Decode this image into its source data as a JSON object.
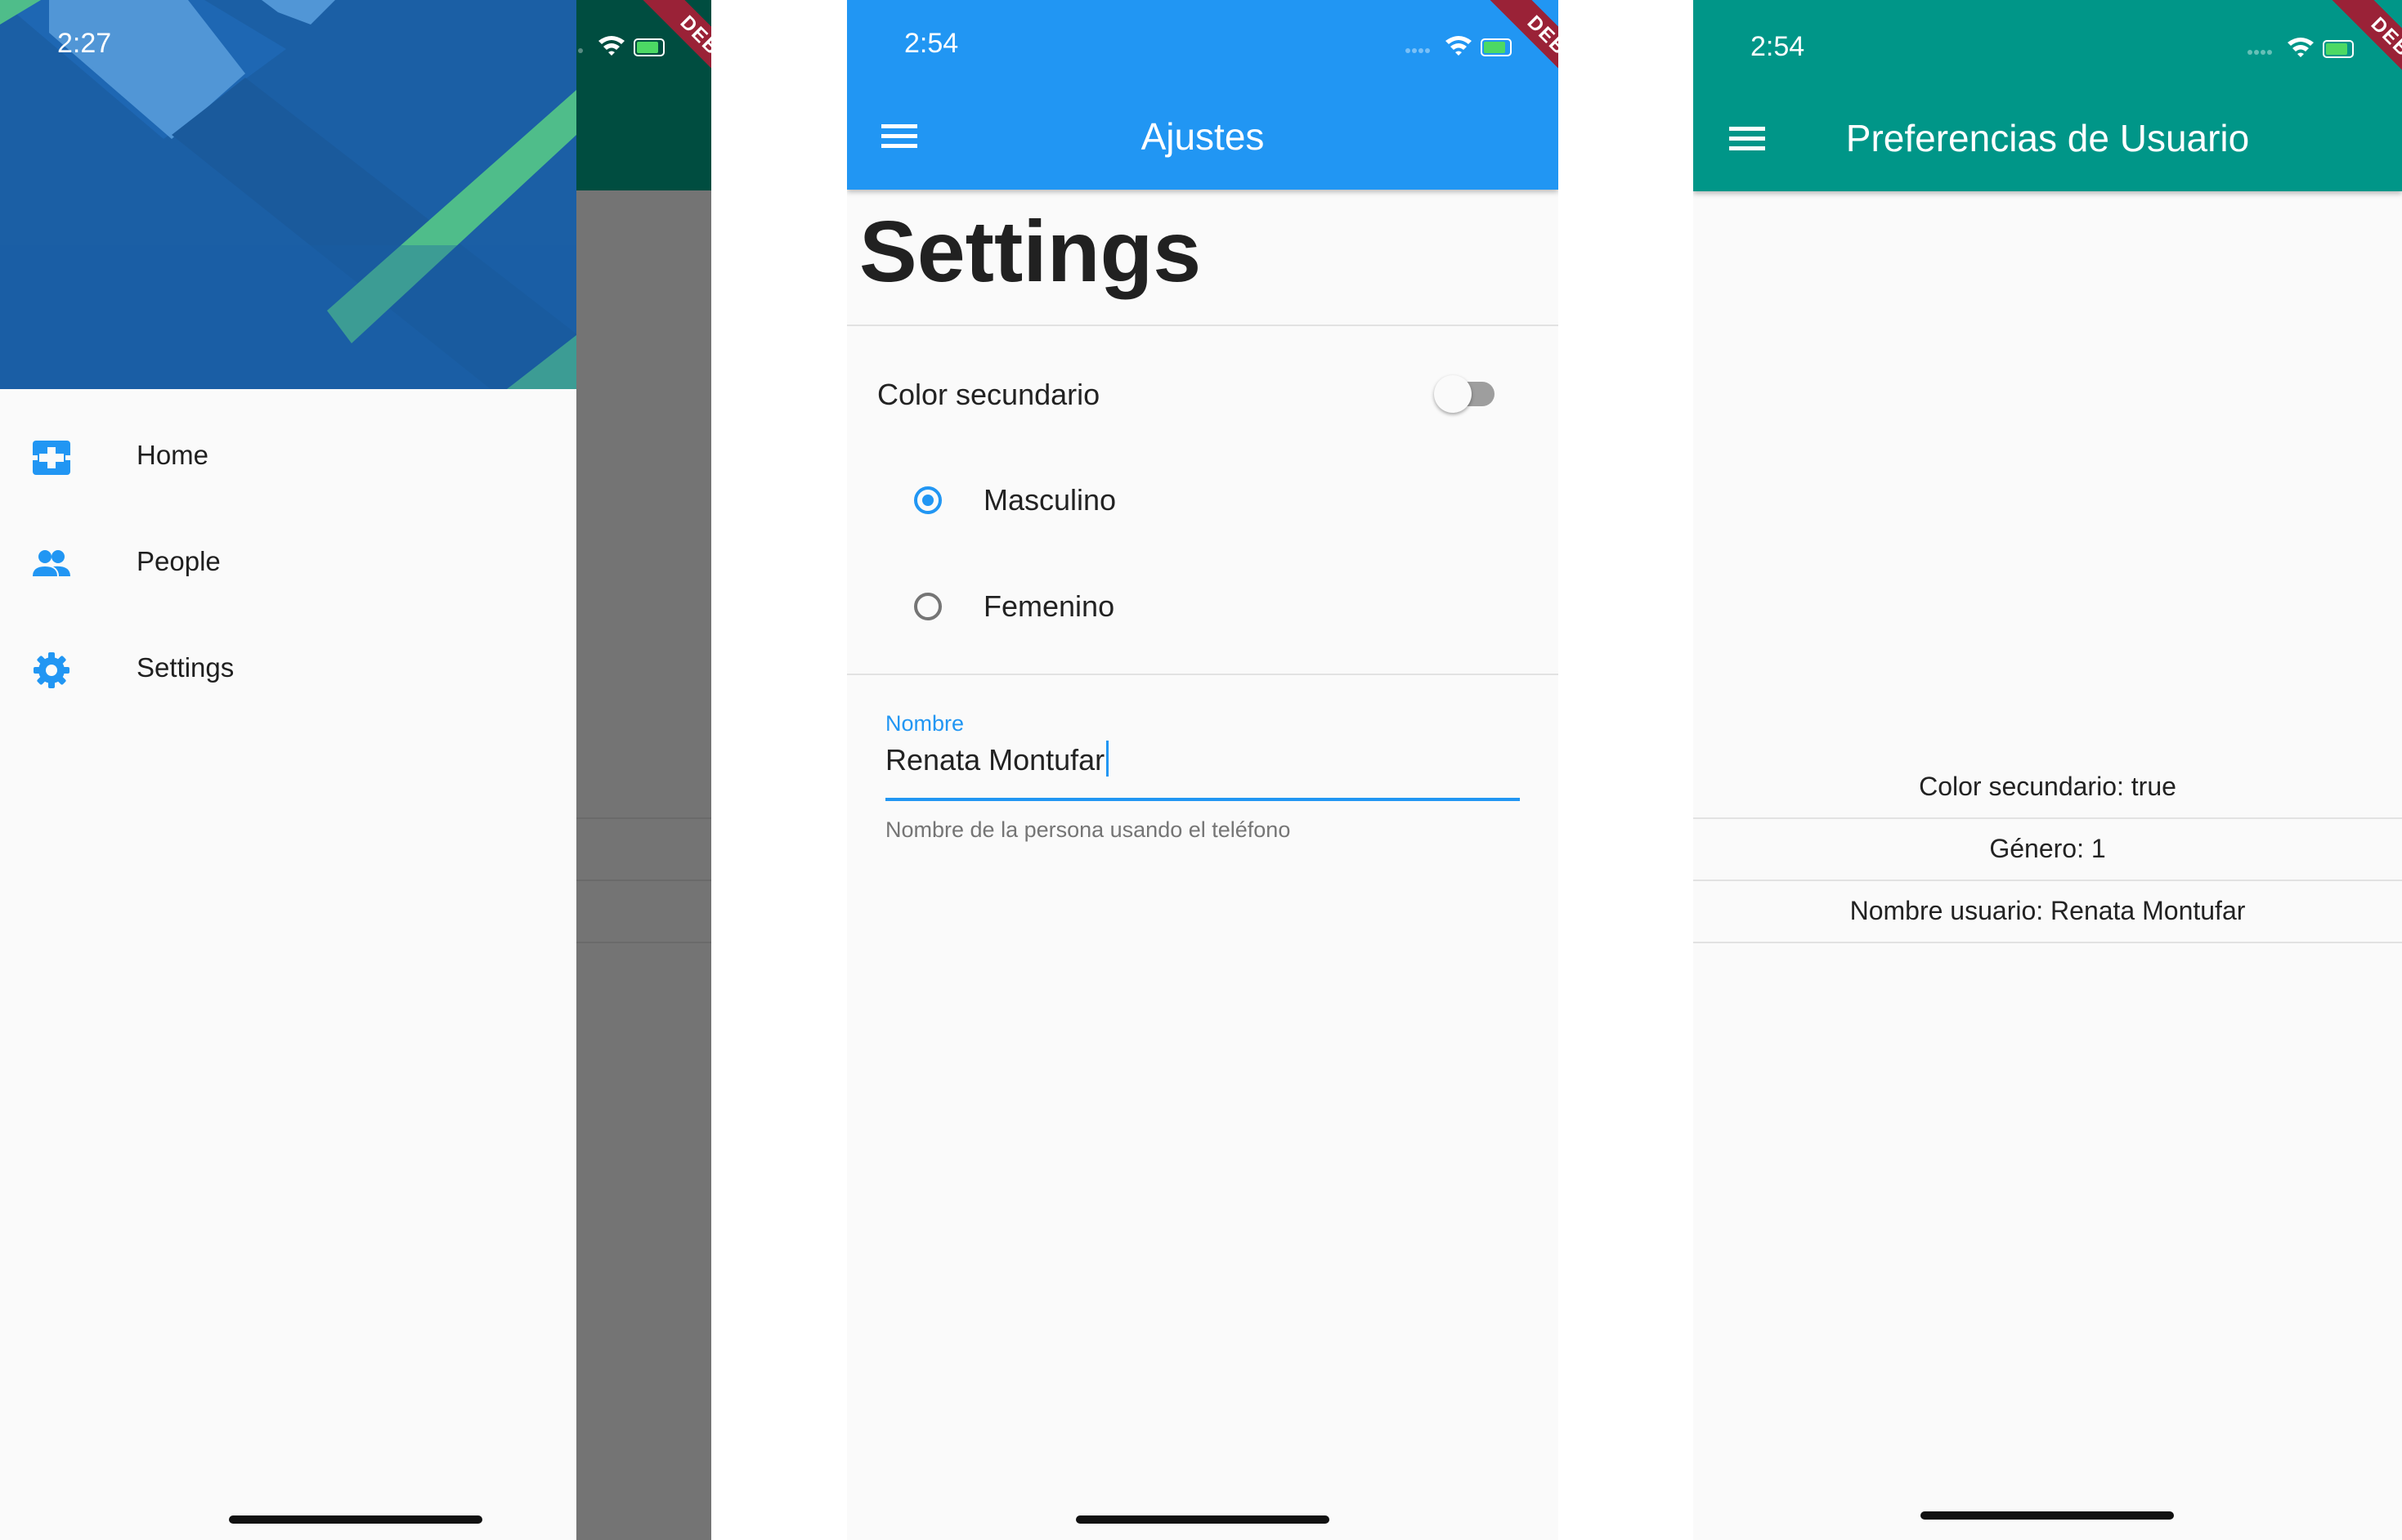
{
  "debug_label": "DEBUG",
  "phone1": {
    "time": "2:27",
    "drawer_items": [
      {
        "label": "Home",
        "icon": "home-icon"
      },
      {
        "label": "People",
        "icon": "people-icon"
      },
      {
        "label": "Settings",
        "icon": "settings-gear-icon"
      }
    ]
  },
  "phone2": {
    "time": "2:54",
    "appbar_title": "Ajustes",
    "page_title": "Settings",
    "switch_label": "Color secundario",
    "switch_on": false,
    "radios": [
      {
        "label": "Masculino",
        "selected": true
      },
      {
        "label": "Femenino",
        "selected": false
      }
    ],
    "field_label": "Nombre",
    "field_value": "Renata Montufar",
    "field_helper": "Nombre de la persona usando el teléfono"
  },
  "phone3": {
    "time": "2:54",
    "appbar_title": "Preferencias de Usuario",
    "rows": [
      "Color secundario: true",
      "Género: 1",
      "Nombre usuario: Renata Montufar"
    ]
  },
  "colors": {
    "blue_primary": "#2196f3",
    "teal_primary": "#009688",
    "drawer_header": "#1b5fa5",
    "drawer_accent": "#4fbd8a",
    "debug_banner": "#9a2237"
  }
}
